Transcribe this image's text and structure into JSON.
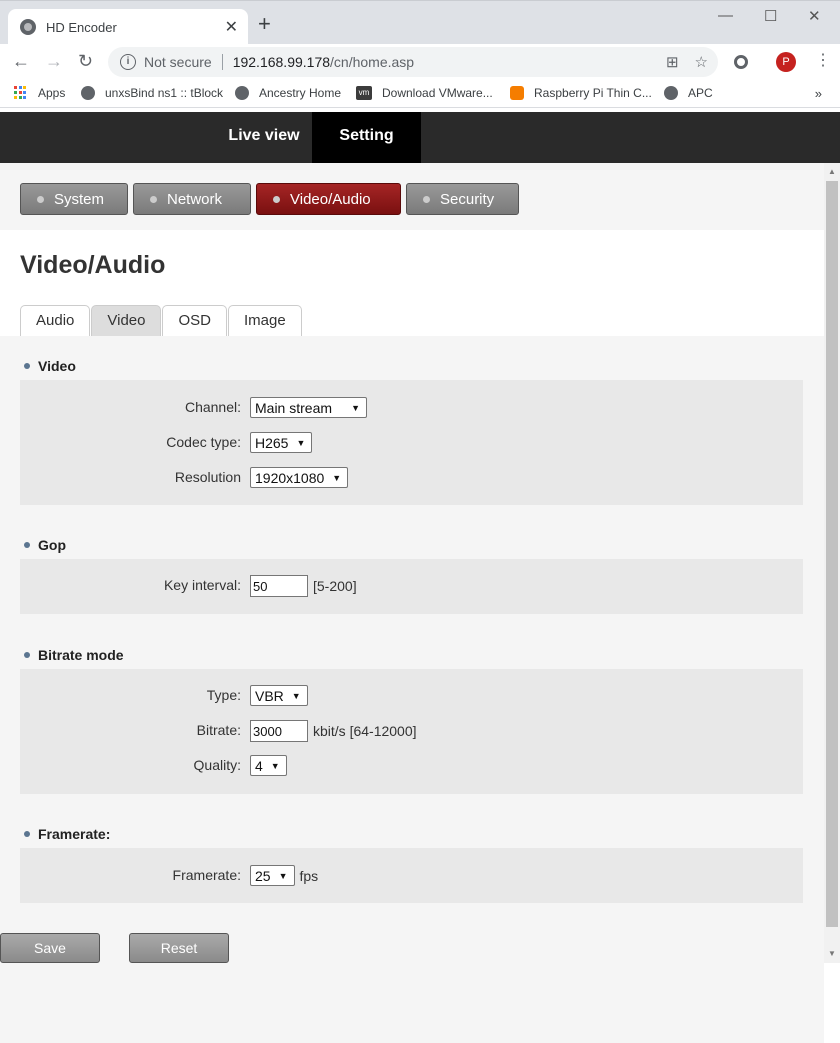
{
  "browser": {
    "tab_title": "HD Encoder",
    "tab_close": "✕",
    "new_tab": "+",
    "window_controls": {
      "minimize": "—",
      "maximize": "☐",
      "close": "✕"
    },
    "nav": {
      "back": "←",
      "forward": "→",
      "reload": "↻"
    },
    "address": {
      "security": "Not secure",
      "host": "192.168.99.178",
      "path": "/cn/home.asp"
    },
    "omnibox_icons": {
      "translate": "⊞",
      "star": "☆"
    },
    "profile_initial": "P",
    "menu": "⋮",
    "bookmarks": [
      {
        "label": "Apps",
        "icon": "apps-icon"
      },
      {
        "label": "unxsBind ns1 :: tBlock",
        "icon": "globe-icon"
      },
      {
        "label": "Ancestry Home",
        "icon": "globe-icon"
      },
      {
        "label": "Download VMware...",
        "icon": "vmware-icon"
      },
      {
        "label": "Raspberry Pi Thin C...",
        "icon": "blogger-icon"
      },
      {
        "label": "APC",
        "icon": "globe-icon"
      }
    ],
    "bookmarks_more": "»"
  },
  "topnav": {
    "live_view": "Live view",
    "setting": "Setting"
  },
  "subnav": [
    "System",
    "Network",
    "Video/Audio",
    "Security"
  ],
  "subnav_active": "Video/Audio",
  "page_title": "Video/Audio",
  "tabs": [
    "Audio",
    "Video",
    "OSD",
    "Image"
  ],
  "active_tab": "Video",
  "sections": {
    "video": {
      "title": "Video",
      "channel": {
        "label": "Channel:",
        "value": "Main stream"
      },
      "codec": {
        "label": "Codec type:",
        "value": "H265"
      },
      "resolution": {
        "label": "Resolution",
        "value": "1920x1080"
      }
    },
    "gop": {
      "title": "Gop",
      "key_interval": {
        "label": "Key interval:",
        "value": "50",
        "range": "[5-200]"
      }
    },
    "bitrate": {
      "title": "Bitrate mode",
      "type": {
        "label": "Type:",
        "value": "VBR"
      },
      "bitrate": {
        "label": "Bitrate:",
        "value": "3000",
        "unit": "kbit/s [64-12000]"
      },
      "quality": {
        "label": "Quality:",
        "value": "4"
      }
    },
    "framerate": {
      "title": "Framerate:",
      "framerate": {
        "label": "Framerate:",
        "value": "25",
        "unit": "fps"
      }
    }
  },
  "buttons": {
    "save": "Save",
    "reset": "Reset"
  },
  "colors": {
    "active_subnav": "#8b1515",
    "topnav_bg": "#2a2a2a",
    "panel_bg": "#e8e8e8"
  }
}
